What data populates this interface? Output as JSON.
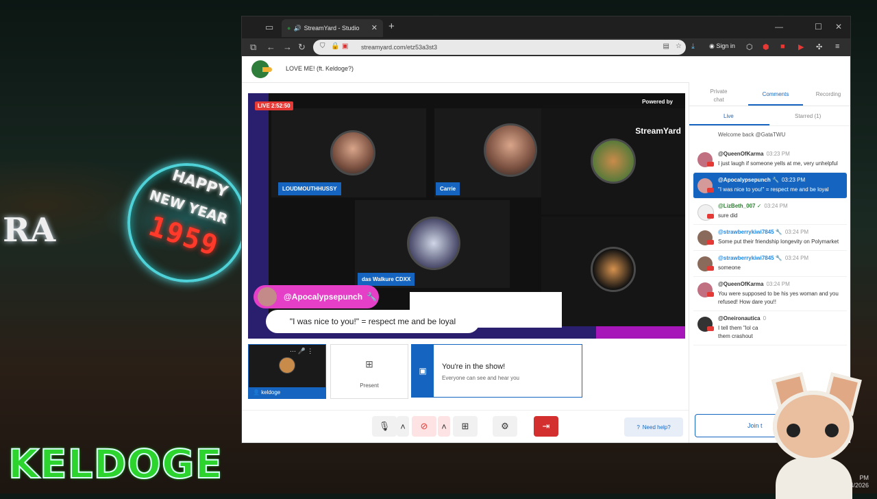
{
  "desktop": {
    "neon_happy": "HAPPY",
    "neon_new_year": "NEW YEAR",
    "neon_year": "1959",
    "neon_side": "RA",
    "overlay_name": "KELDOGE",
    "clock_time": "PM",
    "clock_date": "14/2026"
  },
  "browser": {
    "tab_title": "StreamYard - Studio",
    "url": "streamyard.com/etz53a3st3",
    "sign_in": "Sign in"
  },
  "studio": {
    "broadcast_title": "LOVE ME! (ft. Keldoge?)",
    "live_badge": "LIVE 2:52:50",
    "powered_by": "Powered by",
    "logo_text": "StreamYard",
    "participants": [
      "LOUDMOUTHHUSSY",
      "Carrie",
      "das Walkure CDXX"
    ],
    "lower_third_name": "@Apocalypsepunch",
    "lower_third_msg": "\"I was nice to you!\" = respect me and be loyal",
    "self_label": "keldoge",
    "present_label": "Present",
    "in_show_title": "You're in the show!",
    "in_show_sub": "Everyone can see and hear you",
    "need_help": "Need help?"
  },
  "panel": {
    "tabs": [
      "Private chat",
      "Comments",
      "Recording"
    ],
    "subtabs": [
      "Live",
      "Starred (1)"
    ],
    "welcome": "Welcome back @GataTWU",
    "messages": [
      {
        "who": "@QueenOfKarma",
        "time": "03:23 PM",
        "body": "I just laugh if someone yells at me, very unhelpful"
      },
      {
        "who": "@Apocalypsepunch",
        "time": "03:23 PM",
        "body": "\"I was nice to you!\" = respect me and be loyal"
      },
      {
        "who": "@LizBeth_007",
        "time": "03:24 PM",
        "body": "sure did"
      },
      {
        "who": "@strawberrykiwi7845",
        "time": "03:24 PM",
        "body": "Some put their friendship longevity on Polymarket"
      },
      {
        "who": "@strawberrykiwi7845",
        "time": "03:24 PM",
        "body": "someone"
      },
      {
        "who": "@QueenOfKarma",
        "time": "03:24 PM",
        "body": "You were supposed to be his yes woman and you refused! How dare you!!"
      },
      {
        "who": "@Oneironautica",
        "time": "0",
        "body": "I tell them \"lol ca"
      },
      {
        "who": "",
        "time": "",
        "body": "them crashout"
      }
    ],
    "join_label": "Join t"
  }
}
